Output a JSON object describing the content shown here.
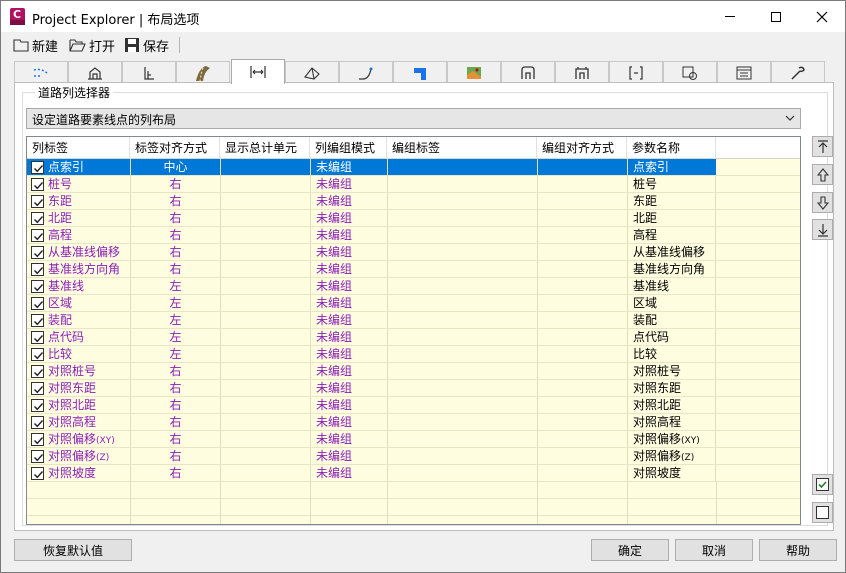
{
  "window": {
    "title": "Project Explorer | 布局选项",
    "app_icon_letter": "C"
  },
  "toolbar": {
    "new_label": "新建",
    "open_label": "打开",
    "save_label": "保存"
  },
  "tabs": [
    {
      "icon": "alignment-dashed-icon"
    },
    {
      "icon": "cross-section-icon"
    },
    {
      "icon": "profile-icon"
    },
    {
      "icon": "road-lane-icon",
      "active": true
    },
    {
      "icon": "offset-arrows-icon"
    },
    {
      "icon": "surface-house-icon"
    },
    {
      "icon": "curve-icon"
    },
    {
      "icon": "pipe-icon"
    },
    {
      "icon": "map-icon"
    },
    {
      "icon": "structure-icon"
    },
    {
      "icon": "structure-alt-icon"
    },
    {
      "icon": "bracket-icon"
    },
    {
      "icon": "target-box-icon"
    },
    {
      "icon": "list-panel-icon"
    },
    {
      "icon": "wrench-icon"
    }
  ],
  "group": {
    "title": "道路列选择器",
    "combo_value": "设定道路要素线点的列布局"
  },
  "grid": {
    "headers": [
      "列标签",
      "标签对齐方式",
      "显示总计单元",
      "列编组模式",
      "编组标签",
      "编组对齐方式",
      "参数名称"
    ],
    "rows": [
      {
        "label": "点索引",
        "align": "中心",
        "mode": "未编组",
        "param": "点索引",
        "checked": true,
        "selected": true
      },
      {
        "label": "桩号",
        "align": "右",
        "mode": "未编组",
        "param": "桩号",
        "checked": true
      },
      {
        "label": "东距",
        "align": "右",
        "mode": "未编组",
        "param": "东距",
        "checked": true
      },
      {
        "label": "北距",
        "align": "右",
        "mode": "未编组",
        "param": "北距",
        "checked": true
      },
      {
        "label": "高程",
        "align": "右",
        "mode": "未编组",
        "param": "高程",
        "checked": true
      },
      {
        "label": "从基准线偏移",
        "align": "右",
        "mode": "未编组",
        "param": "从基准线偏移",
        "checked": true
      },
      {
        "label": "基准线方向角",
        "align": "右",
        "mode": "未编组",
        "param": "基准线方向角",
        "checked": true
      },
      {
        "label": "基准线",
        "align": "左",
        "mode": "未编组",
        "param": "基准线",
        "checked": true
      },
      {
        "label": "区域",
        "align": "左",
        "mode": "未编组",
        "param": "区域",
        "checked": true
      },
      {
        "label": "装配",
        "align": "左",
        "mode": "未编组",
        "param": "装配",
        "checked": true
      },
      {
        "label": "点代码",
        "align": "左",
        "mode": "未编组",
        "param": "点代码",
        "checked": true
      },
      {
        "label": "比较",
        "align": "左",
        "mode": "未编组",
        "param": "比较",
        "checked": true
      },
      {
        "label": "对照桩号",
        "align": "右",
        "mode": "未编组",
        "param": "对照桩号",
        "checked": true
      },
      {
        "label": "对照东距",
        "align": "右",
        "mode": "未编组",
        "param": "对照东距",
        "checked": true
      },
      {
        "label": "对照北距",
        "align": "右",
        "mode": "未编组",
        "param": "对照北距",
        "checked": true
      },
      {
        "label": "对照高程",
        "align": "右",
        "mode": "未编组",
        "param": "对照高程",
        "checked": true
      },
      {
        "label": "对照偏移",
        "label_suffix": "(XY)",
        "align": "右",
        "mode": "未编组",
        "param": "对照偏移",
        "param_suffix": "(XY)",
        "checked": true
      },
      {
        "label": "对照偏移",
        "label_suffix": "(Z)",
        "align": "右",
        "mode": "未编组",
        "param": "对照偏移",
        "param_suffix": "(Z)",
        "checked": true
      },
      {
        "label": "对照坡度",
        "align": "右",
        "mode": "未编组",
        "param": "对照坡度",
        "checked": true
      }
    ]
  },
  "side_buttons": [
    "move-to-top-icon",
    "move-up-icon",
    "move-down-icon",
    "move-to-bottom-icon",
    "check-all-icon",
    "uncheck-all-icon"
  ],
  "buttons": {
    "reset_label": "恢复默认值",
    "ok_label": "确定",
    "cancel_label": "取消",
    "help_label": "帮助"
  },
  "colors": {
    "accent": "#0078d7",
    "label_purple": "#8a1fb8",
    "grid_yellow": "#fffde0"
  }
}
